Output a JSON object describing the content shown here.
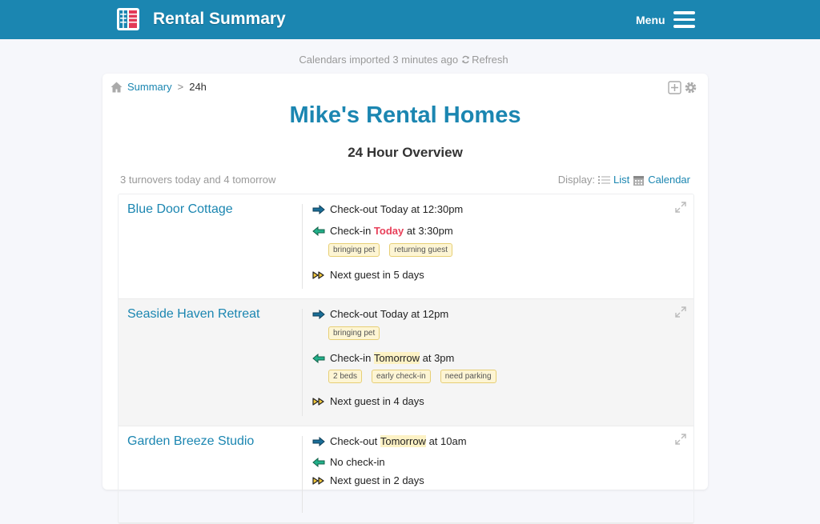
{
  "header": {
    "app_title": "Rental Summary",
    "menu_label": "Menu"
  },
  "import_status": {
    "text": "Calendars imported 3 minutes ago",
    "refresh_label": "Refresh"
  },
  "breadcrumb": {
    "home": "Summary",
    "separator": ">",
    "current": "24h"
  },
  "page": {
    "title": "Mike's Rental Homes",
    "subtitle": "24 Hour Overview"
  },
  "summary_text": "3 turnovers today and 4 tomorrow",
  "display": {
    "label": "Display:",
    "list": "List",
    "calendar": "Calendar"
  },
  "properties": [
    {
      "name": "Blue Door Cottage",
      "checkout": {
        "prefix": "Check-out",
        "day": "Today",
        "suffix": "at 12:30pm"
      },
      "checkin": {
        "prefix": "Check-in",
        "day": "Today",
        "suffix": "at 3:30pm"
      },
      "checkin_tags": [
        "bringing pet",
        "returning guest"
      ],
      "next_guest": "Next guest in 5 days"
    },
    {
      "name": "Seaside Haven Retreat",
      "checkout": {
        "prefix": "Check-out",
        "day": "Today",
        "suffix": "at 12pm"
      },
      "checkout_tags": [
        "bringing pet"
      ],
      "checkin": {
        "prefix": "Check-in",
        "day": "Tomorrow",
        "suffix": "at 3pm"
      },
      "checkin_tags": [
        "2 beds",
        "early check-in",
        "need parking"
      ],
      "next_guest": "Next guest in 4 days"
    },
    {
      "name": "Garden Breeze Studio",
      "checkout": {
        "prefix": "Check-out",
        "day": "Tomorrow",
        "suffix": "at 10am"
      },
      "checkin_text": "No check-in",
      "next_guest": "Next guest in 2 days"
    }
  ],
  "colors": {
    "brand": "#1b86b1",
    "today_red": "#e8405a",
    "highlight_yellow": "#fdf2c5",
    "checkout_arrow": "#1a6e98",
    "checkin_arrow": "#22b08a"
  },
  "icons": [
    "app-logo-icon",
    "hamburger-icon",
    "refresh-icon",
    "home-icon",
    "add-icon",
    "gear-icon",
    "list-icon",
    "calendar-icon",
    "expand-icon",
    "checkout-arrow-icon",
    "checkin-arrow-icon",
    "next-guest-icon"
  ]
}
